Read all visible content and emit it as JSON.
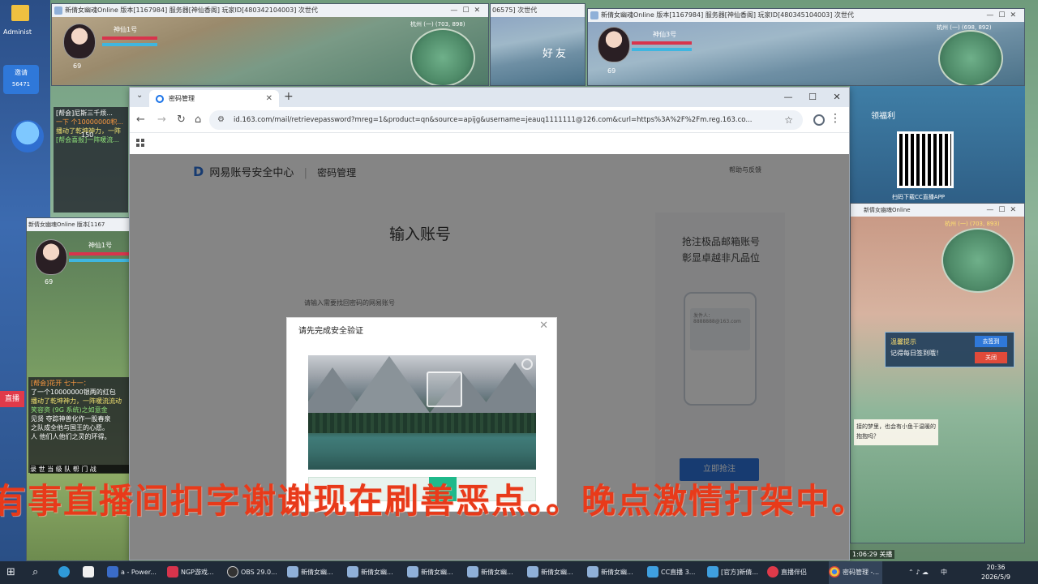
{
  "desktop": {
    "user_label": "Administ",
    "invite_label": "邀请",
    "invite_count": "56471",
    "live_label": "直播"
  },
  "games": {
    "top_left_title": "新倩女幽魂Online 版本[1167984] 服务器[神仙香阁] 玩家ID[480342104003] 次世代",
    "top_mid_title": "06575] 次世代",
    "top_right_title": "新倩女幽魂Online 版本[1167984] 服务器[神仙香阁] 玩家ID[480345104003] 次世代",
    "left_title": "新倩女幽魂Online 版本[1167",
    "p1_name": "神仙1号",
    "p2_name": "神仙3号",
    "p3_name": "神仙1号",
    "level1": "69",
    "level2": "150",
    "friend_label": "好友",
    "coords_top": "杭州 (一) (703, 898)",
    "coords_right": "杭州 (一) (698, 892)",
    "coords_right2": "杭州 (一) (703, 893)",
    "reward_label": "领福利",
    "qr_caption": "扫码下载CC直播APP",
    "tip_title": "温馨提示",
    "tip_text": "记得每日签到哦！",
    "tip_btn1": "去签到",
    "tip_btn2": "关闭",
    "npc_text": "接的梦里，也会有小鱼干温暖的抱抱吗？",
    "chat_lines": [
      "[帮会]尼斯三千烦...",
      "一下 个10000000积...",
      "播动了乾坤神力，一阵",
      "[帮会喜报]一阵暖流...",
      "[帮会]花开 七十一：",
      "了一个10000000银两的红包",
      "播动了乾坤神力，一阵暖流流动",
      "笑容资 (9G 系统)之如意金",
      "见贤 夺踪神兽化作一股春泉",
      "之队成全他与国王的心愿。",
      "人 他们人他们之灵的环得。"
    ],
    "chat_tabs": "录 世 当 级 队 帮 门 战"
  },
  "browser": {
    "tab_title": "密码管理",
    "url": "id.163.com/mail/retrievepassword?mreg=1&product=qn&source=apijg&username=jeauq1111111@126.com&curl=https%3A%2F%2Fm.reg.163.co...",
    "brand_name": "网易账号安全中心",
    "brand_section": "密码管理",
    "help_link": "帮助与反馈",
    "page_heading": "输入账号",
    "input_hint": "请输入需要找回密码的网易账号",
    "promo_line1": "抢注极品邮箱账号",
    "promo_line2": "彰显卓越非凡品位",
    "promo_mail_from": "发件人：",
    "promo_mail_addr": "8888888@163.com",
    "promo_button": "立即抢注",
    "captcha_title": "请先完成安全验证"
  },
  "overlay_text": "有事直播间扣字谢谢现在刷善恶点。。晚点激情打架中。",
  "taskbar": {
    "items": [
      "a - Power...",
      "NGP游戏...",
      "OBS 29.0...",
      "新倩女幽...",
      "新倩女幽...",
      "新倩女幽...",
      "新倩女幽...",
      "新倩女幽...",
      "新倩女幽...",
      "CC直播 3...",
      "[官方]新倩...",
      "直播伴侣",
      "密码管理 -..."
    ],
    "clock_time": "20:36",
    "clock_date": "2026/5/9",
    "stream_time": "1:06:29 关播",
    "ime": "中"
  },
  "colors": {
    "accent": "#2d72d9",
    "slider": "#1fb98b",
    "overlay_text": "#e83a1a"
  }
}
